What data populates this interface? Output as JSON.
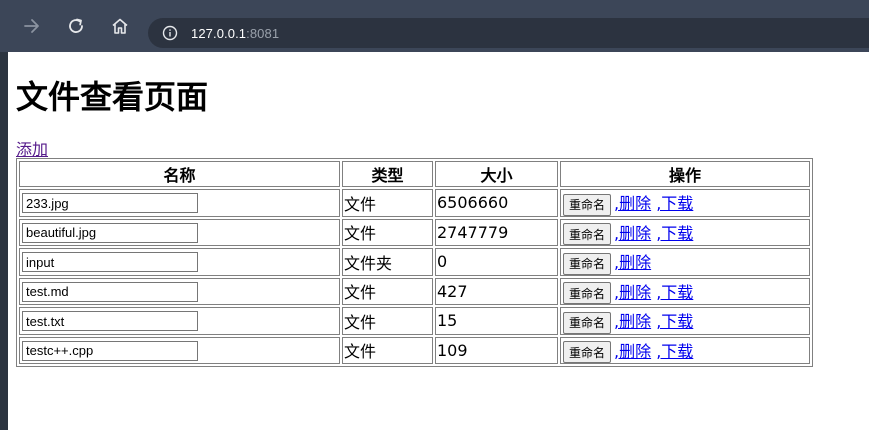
{
  "browser": {
    "url_host": "127.0.0.1",
    "url_port": ":8081"
  },
  "page": {
    "heading": "文件查看页面",
    "add_link": "添加"
  },
  "table": {
    "headers": [
      "名称",
      "类型",
      "大小",
      "操作"
    ],
    "rows": [
      {
        "name": "233.jpg",
        "type": "文件",
        "size": "6506660",
        "rename": "重命名",
        "delete": ",删除",
        "download": ",下载"
      },
      {
        "name": "beautiful.jpg",
        "type": "文件",
        "size": "2747779",
        "rename": "重命名",
        "delete": ",删除",
        "download": ",下载"
      },
      {
        "name": "input",
        "type": "文件夹",
        "size": "0",
        "rename": "重命名",
        "delete": ",删除",
        "download": null
      },
      {
        "name": "test.md",
        "type": "文件",
        "size": "427",
        "rename": "重命名",
        "delete": ",删除",
        "download": ",下载"
      },
      {
        "name": "test.txt",
        "type": "文件",
        "size": "15",
        "rename": "重命名",
        "delete": ",删除",
        "download": ",下载"
      },
      {
        "name": "testc++.cpp",
        "type": "文件",
        "size": "109",
        "rename": "重命名",
        "delete": ",删除",
        "download": ",下载"
      }
    ]
  }
}
